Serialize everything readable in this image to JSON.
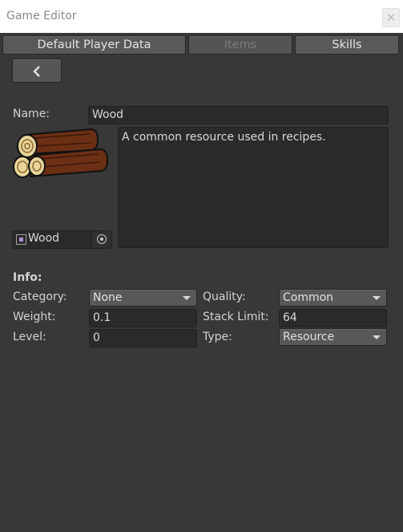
{
  "window": {
    "title": "Game Editor"
  },
  "tabs": [
    {
      "label": "Default Player Data",
      "enabled": true
    },
    {
      "label": "Items",
      "enabled": false
    },
    {
      "label": "Skills",
      "enabled": true
    }
  ],
  "item": {
    "name_label": "Name:",
    "name": "Wood",
    "description": "A common resource used in recipes.",
    "sprite_name": "Wood",
    "icon": "wood-logs-sprite"
  },
  "info": {
    "heading": "Info:",
    "category_label": "Category:",
    "category": "None",
    "weight_label": "Weight:",
    "weight": "0.1",
    "level_label": "Level:",
    "level": "0",
    "quality_label": "Quality:",
    "quality": "Common",
    "stack_limit_label": "Stack Limit:",
    "stack_limit": "64",
    "type_label": "Type:",
    "type": "Resource"
  },
  "colors": {
    "background": "#383838",
    "field": "#2a2a2a",
    "button": "#595959"
  }
}
